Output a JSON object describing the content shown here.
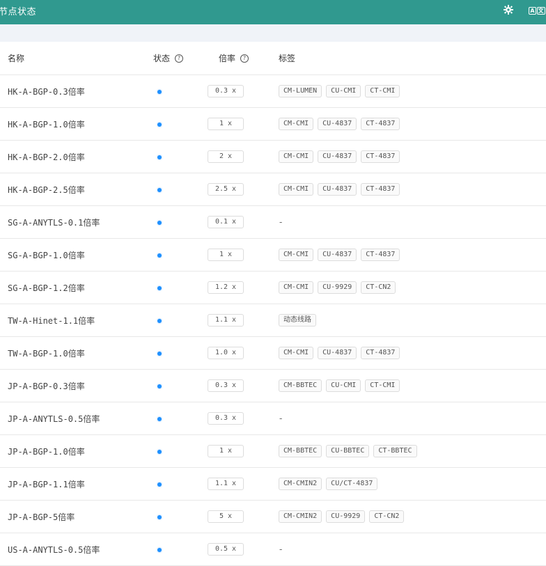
{
  "header": {
    "title": "节点状态",
    "settings_icon": "gear-icon",
    "language_icon": "translate-icon",
    "language_label_left": "A",
    "language_label_right": "文"
  },
  "table": {
    "columns": {
      "name": "名称",
      "status": "状态",
      "rate": "倍率",
      "tags": "标签"
    },
    "rows": [
      {
        "name": "HK-A-BGP-0.3倍率",
        "rate": "0.3 x",
        "tags": [
          "CM-LUMEN",
          "CU-CMI",
          "CT-CMI"
        ]
      },
      {
        "name": "HK-A-BGP-1.0倍率",
        "rate": "1 x",
        "tags": [
          "CM-CMI",
          "CU-4837",
          "CT-4837"
        ]
      },
      {
        "name": "HK-A-BGP-2.0倍率",
        "rate": "2 x",
        "tags": [
          "CM-CMI",
          "CU-4837",
          "CT-4837"
        ]
      },
      {
        "name": "HK-A-BGP-2.5倍率",
        "rate": "2.5 x",
        "tags": [
          "CM-CMI",
          "CU-4837",
          "CT-4837"
        ]
      },
      {
        "name": "SG-A-ANYTLS-0.1倍率",
        "rate": "0.1 x",
        "tags": []
      },
      {
        "name": "SG-A-BGP-1.0倍率",
        "rate": "1 x",
        "tags": [
          "CM-CMI",
          "CU-4837",
          "CT-4837"
        ]
      },
      {
        "name": "SG-A-BGP-1.2倍率",
        "rate": "1.2 x",
        "tags": [
          "CM-CMI",
          "CU-9929",
          "CT-CN2"
        ]
      },
      {
        "name": "TW-A-Hinet-1.1倍率",
        "rate": "1.1 x",
        "tags": [
          "动态线路"
        ]
      },
      {
        "name": "TW-A-BGP-1.0倍率",
        "rate": "1.0 x",
        "tags": [
          "CM-CMI",
          "CU-4837",
          "CT-4837"
        ]
      },
      {
        "name": "JP-A-BGP-0.3倍率",
        "rate": "0.3 x",
        "tags": [
          "CM-BBTEC",
          "CU-CMI",
          "CT-CMI"
        ]
      },
      {
        "name": "JP-A-ANYTLS-0.5倍率",
        "rate": "0.3 x",
        "tags": []
      },
      {
        "name": "JP-A-BGP-1.0倍率",
        "rate": "1 x",
        "tags": [
          "CM-BBTEC",
          "CU-BBTEC",
          "CT-BBTEC"
        ]
      },
      {
        "name": "JP-A-BGP-1.1倍率",
        "rate": "1.1 x",
        "tags": [
          "CM-CMIN2",
          "CU/CT-4837"
        ]
      },
      {
        "name": "JP-A-BGP-5倍率",
        "rate": "5 x",
        "tags": [
          "CM-CMIN2",
          "CU-9929",
          "CT-CN2"
        ]
      },
      {
        "name": "US-A-ANYTLS-0.5倍率",
        "rate": "0.5 x",
        "tags": []
      }
    ],
    "empty_tag_placeholder": "-",
    "status_color": "#1e90ff"
  }
}
